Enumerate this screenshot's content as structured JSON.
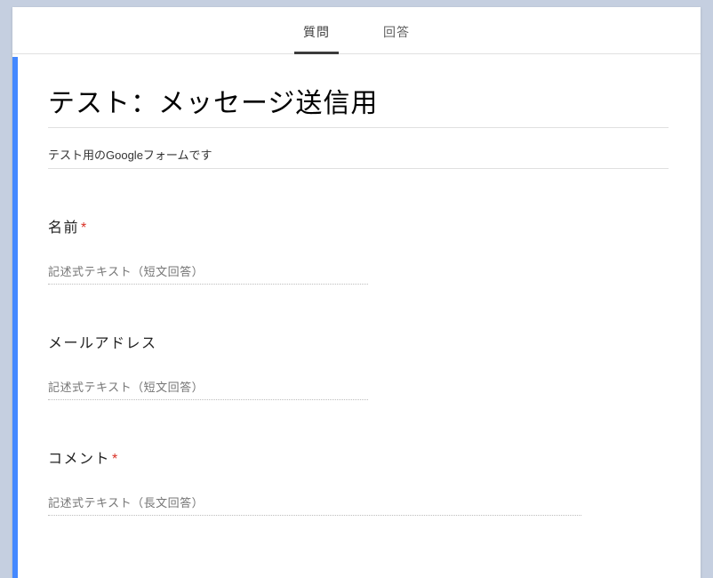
{
  "tabs": {
    "questions": "質問",
    "responses": "回答"
  },
  "form": {
    "title": "テスト：メッセージ送信用",
    "description": "テスト用のGoogleフォームです"
  },
  "questions": [
    {
      "label": "名前",
      "required": true,
      "placeholder": "記述式テキスト（短文回答）",
      "type": "short"
    },
    {
      "label": "メールアドレス",
      "required": false,
      "placeholder": "記述式テキスト（短文回答）",
      "type": "short"
    },
    {
      "label": "コメント",
      "required": true,
      "placeholder": "記述式テキスト（長文回答）",
      "type": "long"
    }
  ],
  "required_mark": "*"
}
